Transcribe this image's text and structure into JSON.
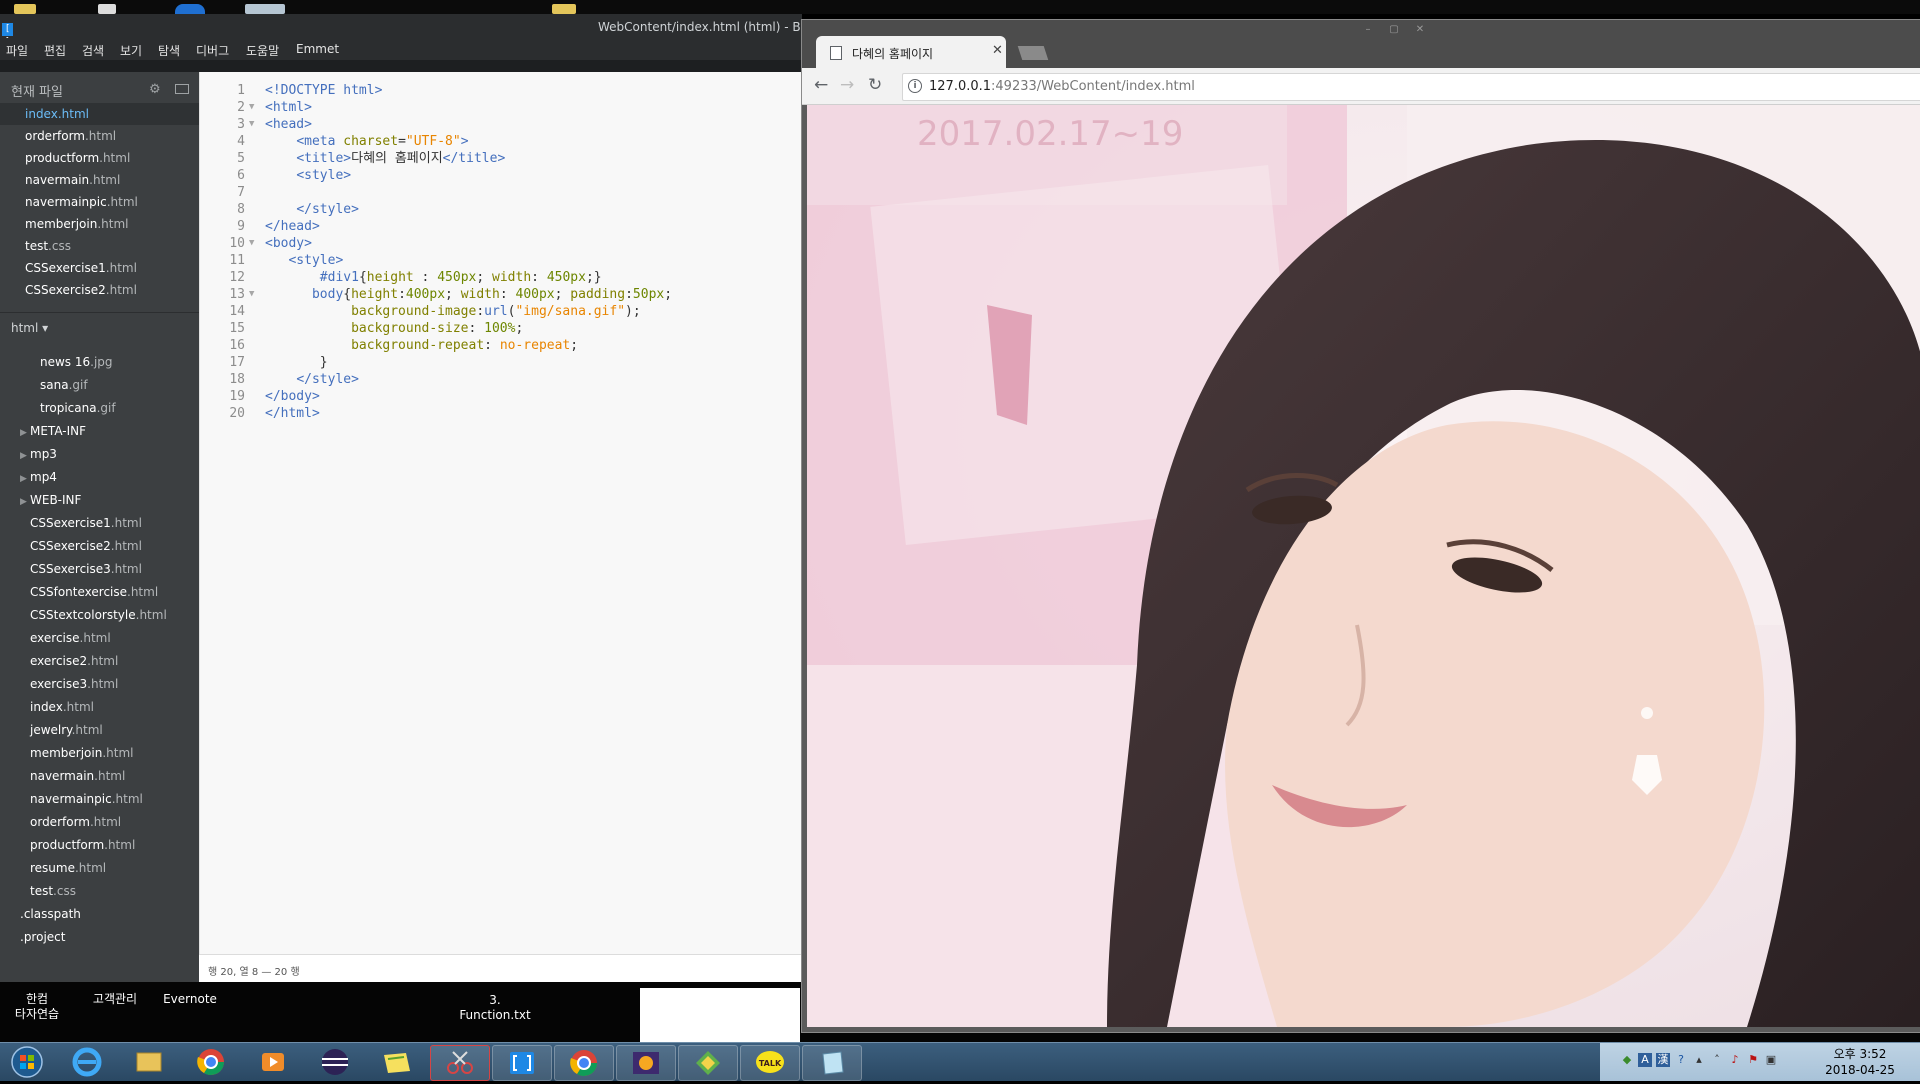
{
  "brackets": {
    "title": "WebContent/index.html (html) - Brackets",
    "menu": [
      "파일",
      "편집",
      "검색",
      "보기",
      "탐색",
      "디버그",
      "도움말",
      "Emmet"
    ],
    "sidebar_header": "현재 파일",
    "working_files": [
      {
        "name": "index",
        "ext": ".html",
        "active": true
      },
      {
        "name": "orderform",
        "ext": ".html"
      },
      {
        "name": "productform",
        "ext": ".html"
      },
      {
        "name": "navermain",
        "ext": ".html"
      },
      {
        "name": "navermainpic",
        "ext": ".html"
      },
      {
        "name": "memberjoin",
        "ext": ".html"
      },
      {
        "name": "test",
        "ext": ".css"
      },
      {
        "name": "CSSexercise1",
        "ext": ".html"
      },
      {
        "name": "CSSexercise2",
        "ext": ".html"
      }
    ],
    "project_selector": "html ▾",
    "tree": [
      {
        "name": "news 16",
        "ext": ".jpg",
        "indent": 2
      },
      {
        "name": "sana",
        "ext": ".gif",
        "indent": 2
      },
      {
        "name": "tropicana",
        "ext": ".gif",
        "indent": 2
      },
      {
        "name": "META-INF",
        "ext": "",
        "indent": 1,
        "folder": true
      },
      {
        "name": "mp3",
        "ext": "",
        "indent": 1,
        "folder": true
      },
      {
        "name": "mp4",
        "ext": "",
        "indent": 1,
        "folder": true
      },
      {
        "name": "WEB-INF",
        "ext": "",
        "indent": 1,
        "folder": true
      },
      {
        "name": "CSSexercise1",
        "ext": ".html",
        "indent": 1
      },
      {
        "name": "CSSexercise2",
        "ext": ".html",
        "indent": 1
      },
      {
        "name": "CSSexercise3",
        "ext": ".html",
        "indent": 1
      },
      {
        "name": "CSSfontexercise",
        "ext": ".html",
        "indent": 1
      },
      {
        "name": "CSStextcolorstyle",
        "ext": ".html",
        "indent": 1
      },
      {
        "name": "exercise",
        "ext": ".html",
        "indent": 1
      },
      {
        "name": "exercise2",
        "ext": ".html",
        "indent": 1
      },
      {
        "name": "exercise3",
        "ext": ".html",
        "indent": 1
      },
      {
        "name": "index",
        "ext": ".html",
        "indent": 1
      },
      {
        "name": "jewelry",
        "ext": ".html",
        "indent": 1
      },
      {
        "name": "memberjoin",
        "ext": ".html",
        "indent": 1
      },
      {
        "name": "navermain",
        "ext": ".html",
        "indent": 1
      },
      {
        "name": "navermainpic",
        "ext": ".html",
        "indent": 1
      },
      {
        "name": "orderform",
        "ext": ".html",
        "indent": 1
      },
      {
        "name": "productform",
        "ext": ".html",
        "indent": 1
      },
      {
        "name": "resume",
        "ext": ".html",
        "indent": 1
      },
      {
        "name": "test",
        "ext": ".css",
        "indent": 1
      },
      {
        "name": ".classpath",
        "ext": "",
        "indent": 0
      },
      {
        "name": ".project",
        "ext": "",
        "indent": 0
      }
    ],
    "code_lines": [
      {
        "n": "1",
        "fold": "",
        "t": [
          [
            "tag",
            "<!DOCTYPE html>"
          ]
        ]
      },
      {
        "n": "2",
        "fold": "▼",
        "t": [
          [
            "tag",
            "<html>"
          ]
        ]
      },
      {
        "n": "3",
        "fold": "▼",
        "t": [
          [
            "tag",
            "<head>"
          ]
        ]
      },
      {
        "n": "4",
        "fold": "",
        "t": [
          [
            "",
            "    "
          ],
          [
            "tag",
            "<meta "
          ],
          [
            "attr",
            "charset"
          ],
          [
            "",
            "="
          ],
          [
            "str",
            "\"UTF-8\""
          ],
          [
            "tag",
            ">"
          ]
        ]
      },
      {
        "n": "5",
        "fold": "",
        "t": [
          [
            "",
            "    "
          ],
          [
            "tag",
            "<title>"
          ],
          [
            "",
            "다혜의 홈페이지"
          ],
          [
            "tag",
            "</title>"
          ]
        ]
      },
      {
        "n": "6",
        "fold": "",
        "t": [
          [
            "",
            "    "
          ],
          [
            "tag",
            "<style>"
          ]
        ]
      },
      {
        "n": "7",
        "fold": "",
        "t": [
          [
            "",
            ""
          ]
        ]
      },
      {
        "n": "8",
        "fold": "",
        "t": [
          [
            "",
            "    "
          ],
          [
            "tag",
            "</style>"
          ]
        ]
      },
      {
        "n": "9",
        "fold": "",
        "t": [
          [
            "tag",
            "</head>"
          ]
        ]
      },
      {
        "n": "10",
        "fold": "▼",
        "t": [
          [
            "tag",
            "<body>"
          ]
        ]
      },
      {
        "n": "11",
        "fold": "",
        "t": [
          [
            "",
            "   "
          ],
          [
            "tag",
            "<style>"
          ]
        ]
      },
      {
        "n": "12",
        "fold": "",
        "t": [
          [
            "",
            "       "
          ],
          [
            "kw",
            "#div1"
          ],
          [
            "",
            "{"
          ],
          [
            "attr",
            "height"
          ],
          [
            "",
            " : "
          ],
          [
            "num",
            "450px"
          ],
          [
            "",
            "; "
          ],
          [
            "attr",
            "width"
          ],
          [
            "",
            ": "
          ],
          [
            "num",
            "450px"
          ],
          [
            "",
            ";}"
          ]
        ]
      },
      {
        "n": "13",
        "fold": "▼",
        "t": [
          [
            "",
            "      "
          ],
          [
            "kw",
            "body"
          ],
          [
            "",
            "{"
          ],
          [
            "attr",
            "height"
          ],
          [
            "",
            ":"
          ],
          [
            "num",
            "400px"
          ],
          [
            "",
            "; "
          ],
          [
            "attr",
            "width"
          ],
          [
            "",
            ": "
          ],
          [
            "num",
            "400px"
          ],
          [
            "",
            "; "
          ],
          [
            "attr",
            "padding"
          ],
          [
            "",
            ":"
          ],
          [
            "num",
            "50px"
          ],
          [
            "",
            ";"
          ]
        ]
      },
      {
        "n": "14",
        "fold": "",
        "t": [
          [
            "",
            "           "
          ],
          [
            "attr",
            "background-image"
          ],
          [
            "",
            ":"
          ],
          [
            "kw",
            "url"
          ],
          [
            "",
            "("
          ],
          [
            "str",
            "\"img/sana.gif\""
          ],
          [
            "",
            ");"
          ]
        ]
      },
      {
        "n": "15",
        "fold": "",
        "t": [
          [
            "",
            "           "
          ],
          [
            "attr",
            "background-size"
          ],
          [
            "",
            ": "
          ],
          [
            "num",
            "100%"
          ],
          [
            "",
            ";"
          ]
        ]
      },
      {
        "n": "16",
        "fold": "",
        "t": [
          [
            "",
            "           "
          ],
          [
            "attr",
            "background-repeat"
          ],
          [
            "",
            ": "
          ],
          [
            "str",
            "no-repeat"
          ],
          [
            "",
            ";"
          ]
        ]
      },
      {
        "n": "17",
        "fold": "",
        "t": [
          [
            "",
            "       }"
          ]
        ]
      },
      {
        "n": "18",
        "fold": "",
        "t": [
          [
            "",
            "    "
          ],
          [
            "tag",
            "</style>"
          ]
        ]
      },
      {
        "n": "19",
        "fold": "",
        "t": [
          [
            "tag",
            "</body>"
          ]
        ]
      },
      {
        "n": "20",
        "fold": "",
        "t": [
          [
            "tag",
            "</html>"
          ]
        ]
      }
    ],
    "status": "행 20, 열 8 — 20 행"
  },
  "desktop_labels": {
    "hanja": "한컴\n타자연습",
    "customer": "고객관리",
    "evernote": "Evernote",
    "function": "3.\nFunction.txt"
  },
  "chrome": {
    "tab_title": "다혜의 홈페이지",
    "url_host": "127.0.0.1",
    "url_rest": ":49233/WebContent/index.html",
    "page_background_text": "2017.02.17~19"
  },
  "taskbar": {
    "apps": [
      "start",
      "ie-icon",
      "explorer-icon",
      "chrome-icon",
      "media-player-icon",
      "eclipse-icon",
      "notes-icon",
      "snipping-tool-icon",
      "brackets-icon",
      "chrome-icon",
      "eclipse-jee-icon",
      "network-icon",
      "kakaotalk-icon",
      "notepad-icon"
    ],
    "clock_time": "오후 3:52",
    "clock_date": "2018-04-25"
  }
}
